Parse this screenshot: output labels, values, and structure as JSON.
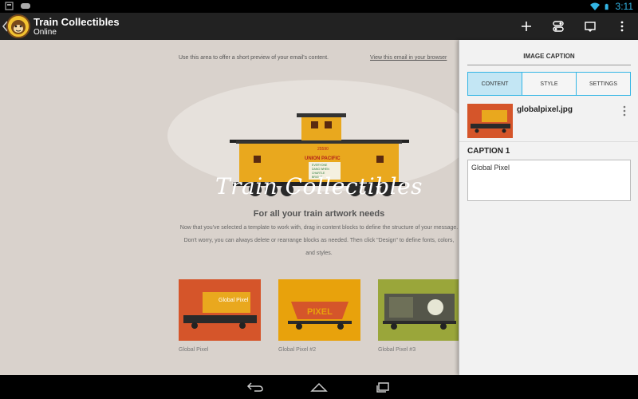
{
  "status": {
    "time": "3:11"
  },
  "actionbar": {
    "title": "Train Collectibles",
    "subtitle": "Online",
    "actions": [
      "add-icon",
      "toggle-icon",
      "preview-icon",
      "overflow-menu-icon"
    ]
  },
  "preview": {
    "preview_text": "Use this area to offer a short preview of your email's content.",
    "view_link": "View this email in your browser",
    "title": "Train Collectibles",
    "subtitle": "For all your train artwork needs",
    "body": "Now that you've selected a template to work with, drag in content blocks to define the structure of your message. Don't worry, you can always delete or rearrange blocks as needed. Then click \"Design\" to define fonts, colors, and styles.",
    "caboose_text": [
      "UNION PACIFIC",
      "25590",
      "EVERYONE",
      "DANG WHEN",
      "CHARTLE",
      "BRIGHT"
    ],
    "thumbnails": [
      {
        "label": "Global Pixel",
        "bg": "#d5552a",
        "art": "Global Pixel"
      },
      {
        "label": "Global Pixel #2",
        "bg": "#e8a20c",
        "art": "PIXEL"
      },
      {
        "label": "Global Pixel #3",
        "bg": "#9aa63a",
        "art": ""
      }
    ]
  },
  "panel": {
    "title": "IMAGE CAPTION",
    "tabs": [
      "CONTENT",
      "STYLE",
      "SETTINGS"
    ],
    "active_tab": "CONTENT",
    "image_name": "globalpixel.jpg",
    "caption_label": "CAPTION 1",
    "caption_value": "Global Pixel"
  },
  "colors": {
    "accent": "#33b5e5",
    "actionbar": "#222222",
    "preview_bg": "#d9d2cc"
  }
}
